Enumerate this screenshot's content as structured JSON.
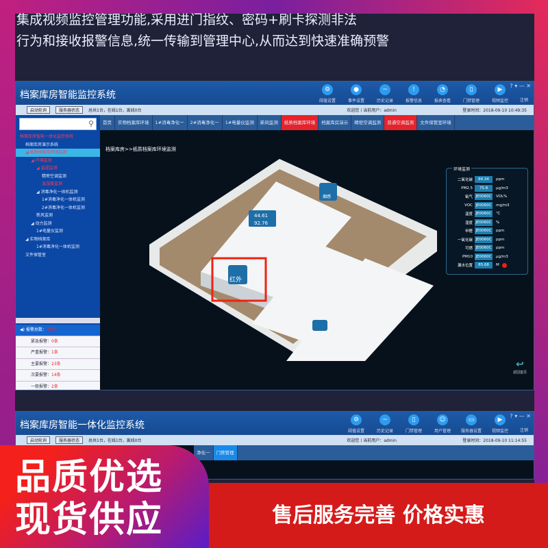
{
  "intro": {
    "line1": "集成视频监控管理功能,采用进门指纹、密码+刷卡探测非法",
    "line2": "行为和接收报警信息,统一传输到管理中心,从而达到快速准确预警"
  },
  "win1": {
    "title": "档案库房智能监控系统",
    "tools": [
      {
        "label": "阈值设置",
        "icon": "gear-icon"
      },
      {
        "label": "事件设置",
        "icon": "bell-icon"
      },
      {
        "label": "历史记录",
        "icon": "wave-icon"
      },
      {
        "label": "报警信息",
        "icon": "alert-icon"
      },
      {
        "label": "报表查看",
        "icon": "pie-chart-icon"
      },
      {
        "label": "门禁管理",
        "icon": "door-icon"
      },
      {
        "label": "视频监控",
        "icon": "play-icon"
      }
    ],
    "logout": "注销",
    "win_buttons": "? ▾ — ✕",
    "sub": {
      "btn1": "启动轮询",
      "btn2": "服务器状态",
      "status": "总共1台，在线1台，离线0台",
      "welcome": "欢迎您丨当前用户：admin",
      "login_time": "登录时间：2018-09-10 10:49:35"
    },
    "tree": [
      {
        "t": "档案库房智能一体化监控系统",
        "c": "red"
      },
      {
        "t": "档案库房演示系统",
        "c": ""
      },
      {
        "t": "◢ 纸质档案库环境监测",
        "c": "red sel"
      },
      {
        "t": "◢ 环境监测",
        "c": "red"
      },
      {
        "t": "◢ 温湿监测",
        "c": "red"
      },
      {
        "t": "精密空调监测",
        "c": ""
      },
      {
        "t": "温湿度监测",
        "c": "red"
      },
      {
        "t": "◢ 消毒净化一体机监测",
        "c": ""
      },
      {
        "t": "1#消毒净化一体机监测",
        "c": ""
      },
      {
        "t": "2#消毒净化一体机监测",
        "c": ""
      },
      {
        "t": "新风监测",
        "c": ""
      },
      {
        "t": "◢ 动力监测",
        "c": ""
      },
      {
        "t": "1#电量仪监测",
        "c": ""
      },
      {
        "t": "◢ 实物档案库",
        "c": ""
      },
      {
        "t": "1#消毒净化一体机监测",
        "c": ""
      },
      {
        "t": "文件保管室",
        "c": ""
      }
    ],
    "alarms": {
      "total_label": "报警总数：",
      "total": "40条",
      "items": [
        {
          "l": "紧急报警：",
          "v": "0条"
        },
        {
          "l": "严重报警：",
          "v": "1条"
        },
        {
          "l": "主要报警：",
          "v": "23条"
        },
        {
          "l": "次要报警：",
          "v": "14条"
        },
        {
          "l": "一般报警：",
          "v": "2条"
        }
      ]
    },
    "tabs": [
      {
        "t": "首页",
        "c": ""
      },
      {
        "t": "实物档案库环境",
        "c": ""
      },
      {
        "t": "1#消毒净化一",
        "c": ""
      },
      {
        "t": "2#消毒净化一",
        "c": ""
      },
      {
        "t": "1#电量仪监测",
        "c": ""
      },
      {
        "t": "新风监测",
        "c": ""
      },
      {
        "t": "纸质档案库环境",
        "c": "red"
      },
      {
        "t": "档案库房演示",
        "c": ""
      },
      {
        "t": "精密空调监测",
        "c": ""
      },
      {
        "t": "普通空调监测",
        "c": "red"
      },
      {
        "t": "文件保管室环境",
        "c": ""
      }
    ],
    "breadcrumb": "档案库房>>纸质档案库环境监测",
    "scene": {
      "temp": "44.61",
      "hum": "92.76",
      "unit": "%",
      "smoke": "烟感",
      "infrared": "红外"
    },
    "env": {
      "title": "环境监测",
      "rows": [
        {
          "l": "二氧化碳",
          "v": "84.34",
          "u": "ppm"
        },
        {
          "l": "PM2.5",
          "v": "75.8",
          "u": "μg/m3"
        },
        {
          "l": "氧气",
          "v": "JE0060C",
          "u": "VOL%"
        },
        {
          "l": "VOC",
          "v": "JE0060C",
          "u": "mg/m3"
        },
        {
          "l": "温度",
          "v": "JE0060C",
          "u": "℃"
        },
        {
          "l": "湿度",
          "v": "JE0060C",
          "u": "%"
        },
        {
          "l": "甲醛",
          "v": "JE0060C",
          "u": "ppm"
        },
        {
          "l": "一氧化碳",
          "v": "JE0060C",
          "u": "ppm"
        },
        {
          "l": "可燃",
          "v": "JE0060C",
          "u": "ppm"
        },
        {
          "l": "PM10",
          "v": "JE0060C",
          "u": "μg/m3"
        },
        {
          "l": "漏水位置",
          "v": "85.68",
          "u": "M"
        }
      ]
    },
    "back": "返回首页"
  },
  "win2": {
    "title": "档案库房智能一体化监控系统",
    "tools": [
      {
        "label": "阈值设置",
        "icon": "gear-icon"
      },
      {
        "label": "历史记录",
        "icon": "wave-icon"
      },
      {
        "label": "门禁管理",
        "icon": "door-icon"
      },
      {
        "label": "用户管理",
        "icon": "user-icon"
      },
      {
        "label": "服务器设置",
        "icon": "monitor-icon"
      },
      {
        "label": "视频监控",
        "icon": "play-icon"
      }
    ],
    "logout": "注销",
    "sub": {
      "btn1": "启动轮询",
      "btn2": "服务器状态",
      "status": "总共1台，在线1台，离线0台",
      "welcome": "欢迎您丨当前用户：admin",
      "login_time": "登录时间：2018-09-10 11:14:55"
    },
    "tabs": [
      {
        "t": "净化一",
        "c": ""
      },
      {
        "t": "门禁管理",
        "c": "blue"
      }
    ]
  },
  "promo": {
    "line1": "品质优选",
    "line2": "现货供应",
    "banner": "售后服务完善  价格实惠"
  }
}
